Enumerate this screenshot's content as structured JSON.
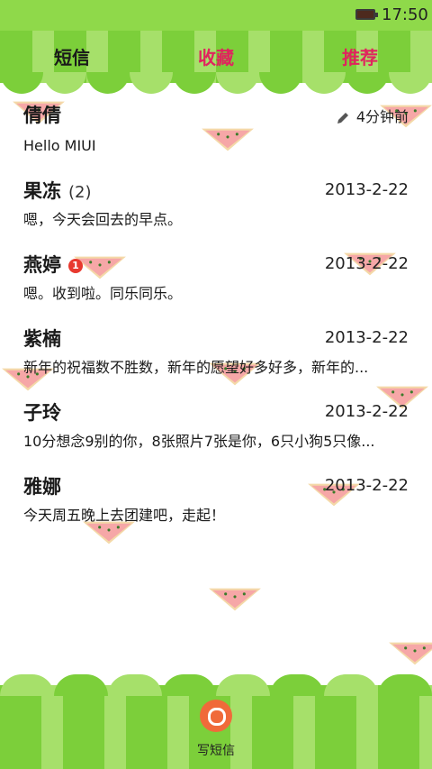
{
  "status": {
    "time": "17:50"
  },
  "tabs": [
    {
      "label": "短信"
    },
    {
      "label": "收藏"
    },
    {
      "label": "推荐"
    }
  ],
  "conversations": [
    {
      "name": "倩倩",
      "meta": "4分钟前",
      "preview": "Hello MIUI"
    },
    {
      "name": "果冻",
      "count": "(2)",
      "meta": "2013-2-22",
      "preview": "嗯，今天会回去的早点。"
    },
    {
      "name": "燕婷",
      "badge": "1",
      "meta": "2013-2-22",
      "preview": "嗯。收到啦。同乐同乐。"
    },
    {
      "name": "紫楠",
      "meta": "2013-2-22",
      "preview": "新年的祝福数不胜数，新年的愿望好多好多，新年的..."
    },
    {
      "name": "子玲",
      "meta": "2013-2-22",
      "preview": "10分想念9别的你，8张照片7张是你，6只小狗5只像..."
    },
    {
      "name": "雅娜",
      "meta": "2013-2-22",
      "preview": "今天周五晚上去团建吧，走起！"
    }
  ],
  "bottom": {
    "compose_label": "写短信"
  },
  "colors": {
    "accent": "#e0245e",
    "green_dark": "#7ccf3a",
    "green_light": "#a6e06a"
  }
}
